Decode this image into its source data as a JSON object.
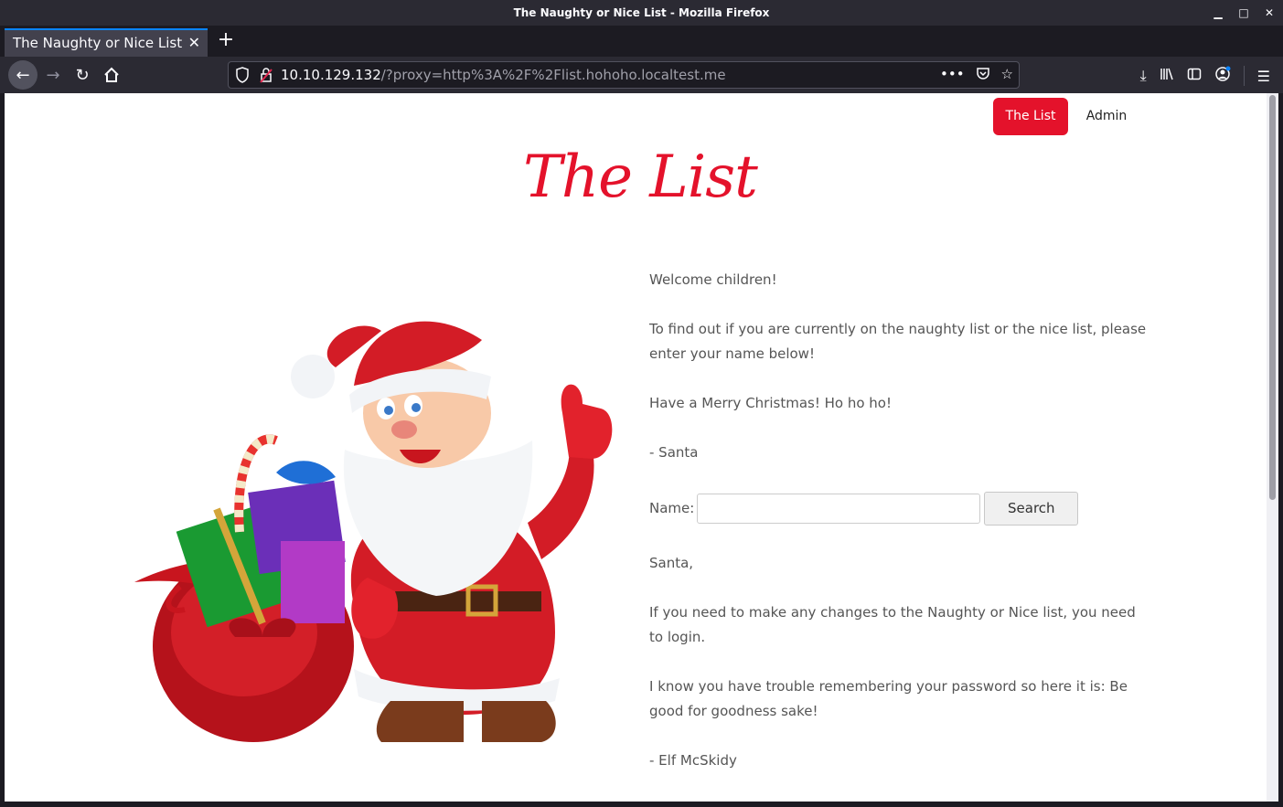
{
  "window": {
    "title": "The Naughty or Nice List - Mozilla Firefox"
  },
  "tab": {
    "title": "The Naughty or Nice List"
  },
  "url": {
    "host": "10.10.129.132",
    "path": "/?proxy=http%3A%2F%2Flist.hohoho.localtest.me"
  },
  "nav": {
    "the_list": "The List",
    "admin": "Admin"
  },
  "page": {
    "title": "The List",
    "paragraphs": [
      "Welcome children!",
      "To find out if you are currently on the naughty list or the nice list, please enter your name below!",
      "Have a Merry Christmas! Ho ho ho!",
      "- Santa"
    ],
    "search": {
      "label": "Name:",
      "value": "",
      "button": "Search"
    },
    "note": [
      "Santa,",
      "If you need to make any changes to the Naughty or Nice list, you need to login.",
      "I know you have trouble remembering your password so here it is: Be good for goodness sake!",
      "- Elf McSkidy"
    ]
  },
  "colors": {
    "accent": "#e4122b",
    "text": "#555555"
  },
  "icons": [
    "back-icon",
    "forward-icon",
    "reload-icon",
    "home-icon",
    "shield-icon",
    "insecure-lock-icon",
    "more-icon",
    "pocket-icon",
    "bookmark-star-icon",
    "download-icon",
    "library-icon",
    "sidebar-icon",
    "account-icon",
    "menu-icon"
  ]
}
